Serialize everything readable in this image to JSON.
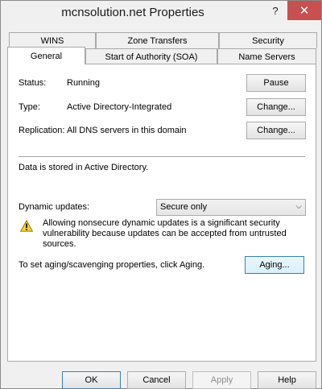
{
  "window": {
    "title": "mcnsolution.net Properties",
    "help_glyph": "?",
    "close_glyph": "✕"
  },
  "tabs": {
    "row_back": [
      "WINS",
      "Zone Transfers",
      "Security"
    ],
    "row_front": [
      "General",
      "Start of Authority (SOA)",
      "Name Servers"
    ],
    "selected": "General"
  },
  "general": {
    "status_label": "Status:",
    "status_value": "Running",
    "pause_button": "Pause",
    "type_label": "Type:",
    "type_value": "Active Directory-Integrated",
    "type_change_button": "Change...",
    "replication_label": "Replication:",
    "replication_value": "All DNS servers in this domain",
    "replication_change_button": "Change...",
    "storage_note": "Data is stored in Active Directory.",
    "dynamic_updates_label": "Dynamic updates:",
    "dynamic_updates_value": "Secure only",
    "warning_text": "Allowing nonsecure dynamic updates is a significant security vulnerability because updates can be accepted from untrusted sources.",
    "aging_text": "To set aging/scavenging properties, click Aging.",
    "aging_button": "Aging..."
  },
  "footer": {
    "ok": "OK",
    "cancel": "Cancel",
    "apply": "Apply",
    "help": "Help"
  },
  "colors": {
    "close_button": "#c75050",
    "warning_fill": "#f5d033",
    "focus_border": "#3c7fb1"
  }
}
